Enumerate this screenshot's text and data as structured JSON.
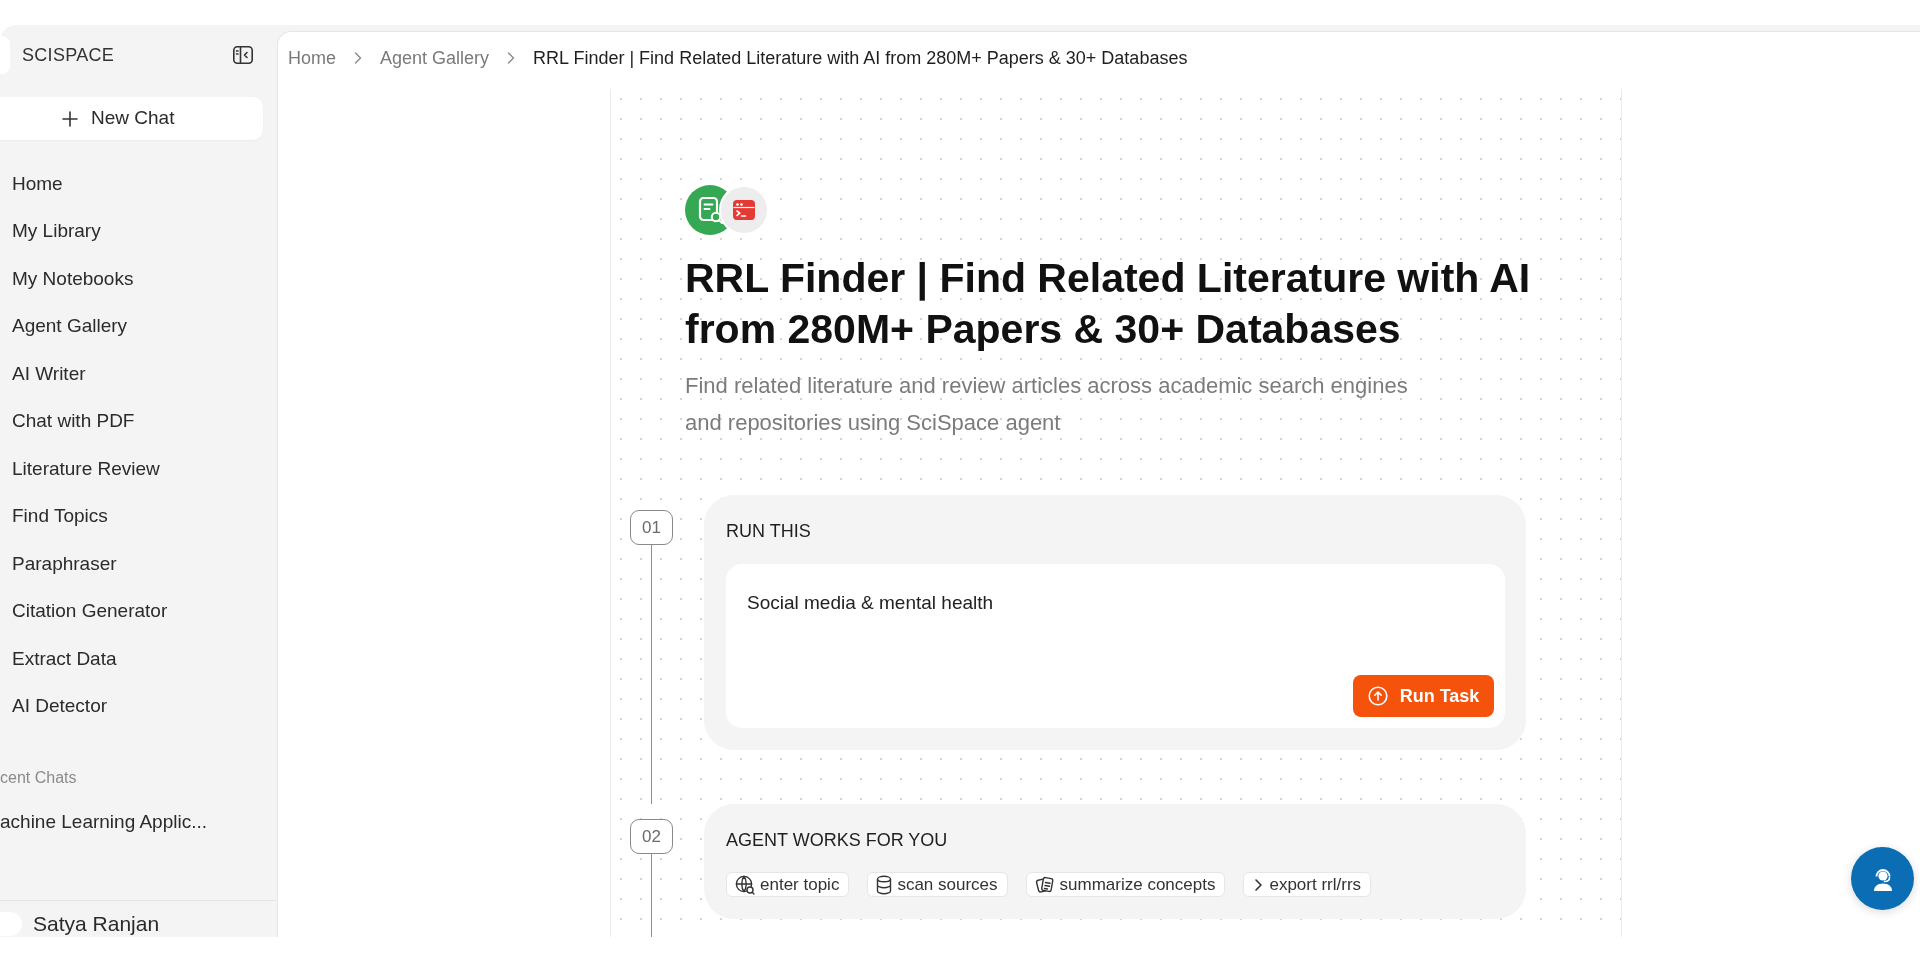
{
  "sidebar": {
    "brand": "SCISPACE",
    "new_chat_button": "New Chat",
    "nav_items": [
      "Home",
      "My Library",
      "My Notebooks",
      "Agent Gallery",
      "AI Writer",
      "Chat with PDF",
      "Literature Review",
      "Find Topics",
      "Paraphraser",
      "Citation Generator",
      "Extract Data",
      "AI Detector"
    ],
    "recent_heading": "cent Chats",
    "recent_chats": [
      "achine Learning Applic..."
    ],
    "user_name": "Satya Ranjan"
  },
  "breadcrumb": [
    {
      "label": "Home",
      "current": false
    },
    {
      "label": "Agent Gallery",
      "current": false
    },
    {
      "label": "RRL Finder | Find Related Literature with AI from 280M+ Papers & 30+ Databases",
      "current": true
    }
  ],
  "agent": {
    "title": "RRL Finder | Find Related Literature with AI from 280M+ Papers & 30+ Databases",
    "description": "Find related literature and review articles across academic search engines and repositories using SciSpace agent"
  },
  "steps": [
    {
      "number": "01",
      "kind": "input",
      "heading": "RUN THIS",
      "value": "Social media & mental health",
      "button": "Run Task"
    },
    {
      "number": "02",
      "kind": "tags",
      "heading": "AGENT WORKS FOR YOU",
      "tags": [
        {
          "kind": "topic",
          "label": "enter topic"
        },
        {
          "kind": "sources",
          "label": "scan sources"
        },
        {
          "kind": "summary",
          "label": "summarize concepts"
        },
        {
          "kind": "export",
          "label": "export rrl/rrs"
        }
      ]
    }
  ]
}
